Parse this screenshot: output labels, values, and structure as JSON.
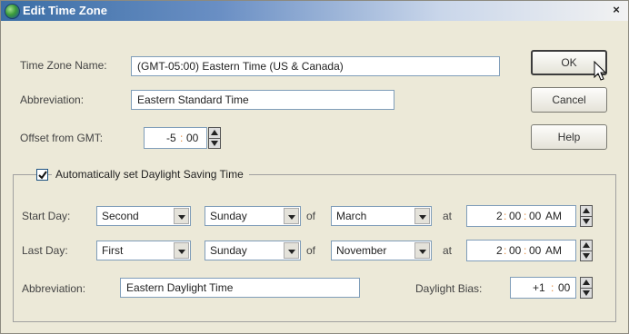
{
  "window": {
    "title": "Edit Time Zone",
    "close_label": "×"
  },
  "fields": {
    "tz_name_label": "Time Zone Name:",
    "tz_name_value": "(GMT-05:00) Eastern Time (US & Canada)",
    "abbr_label": "Abbreviation:",
    "abbr_value": "Eastern Standard Time",
    "offset_label": "Offset from GMT:",
    "offset_hours": "-5",
    "offset_minutes": "00"
  },
  "buttons": {
    "ok": "OK",
    "cancel": "Cancel",
    "help": "Help"
  },
  "dst": {
    "auto_label": "Automatically set Daylight Saving Time",
    "auto_checked": true,
    "start_label": "Start Day:",
    "start_week": "Second",
    "start_weekday": "Sunday",
    "of_label": "of",
    "start_month": "March",
    "at_label": "at",
    "start_time": {
      "hour": "2",
      "minute": "00",
      "second": "00",
      "ampm": "AM"
    },
    "last_label": "Last Day:",
    "last_week": "First",
    "last_weekday": "Sunday",
    "last_month": "November",
    "last_time": {
      "hour": "2",
      "minute": "00",
      "second": "00",
      "ampm": "AM"
    },
    "abbr_label": "Abbreviation:",
    "abbr_value": "Eastern Daylight Time",
    "bias_label": "Daylight Bias:",
    "bias_hours": "+1",
    "bias_minutes": "00"
  },
  "icons": {
    "title": "globe-icon",
    "check": "checkmark-icon",
    "cursor": "mouse-pointer-icon"
  }
}
